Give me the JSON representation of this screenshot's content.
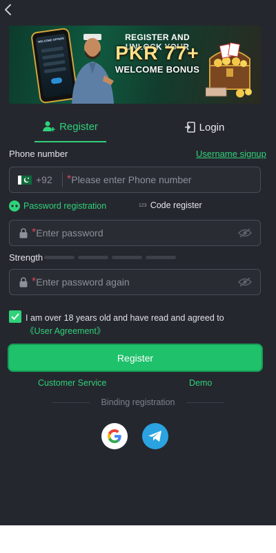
{
  "icons": {
    "back": "chevron-left-icon",
    "register_tab": "add-user-icon",
    "login_tab": "door-login-icon",
    "flag": "pakistan-flag-icon",
    "password_reg": "dots-circle-icon",
    "code_reg": "123-icon",
    "lock": "lock-icon",
    "eye": "eye-off-icon",
    "checkbox": "checkbox-checked-icon",
    "google": "google-icon",
    "telegram": "telegram-icon"
  },
  "banner": {
    "line1": "REGISTER AND UNLOCK YOUR",
    "line2_prefix": "PKR",
    "line2_amount": "77+",
    "line3": "WELCOME BONUS",
    "phone_screen_title": "WELCOME OFFERS"
  },
  "tabs": {
    "register": "Register",
    "login": "Login",
    "active": "register"
  },
  "form": {
    "phone_label": "Phone number",
    "username_link": "Username signup",
    "country_code": "+92",
    "phone_placeholder": "Please enter Phone number",
    "password_registration": "Password registration",
    "code_register": "Code register",
    "password_placeholder": "Enter password",
    "strength_label": "Strength",
    "strength_level": 0,
    "strength_segments": 4,
    "confirm_placeholder": "Enter password again",
    "required_mark": "*",
    "agree_checked": true,
    "agree_text": "I am over 18 years old and have read and agreed to",
    "agreement_link": "《User Agreement》"
  },
  "actions": {
    "register_button": "Register",
    "customer_service": "Customer Service",
    "demo": "Demo",
    "binding_registration": "Binding registration"
  },
  "colors": {
    "accent": "#2fd27a",
    "button": "#1fc16b",
    "background": "#25272e",
    "required": "#e0455a"
  }
}
